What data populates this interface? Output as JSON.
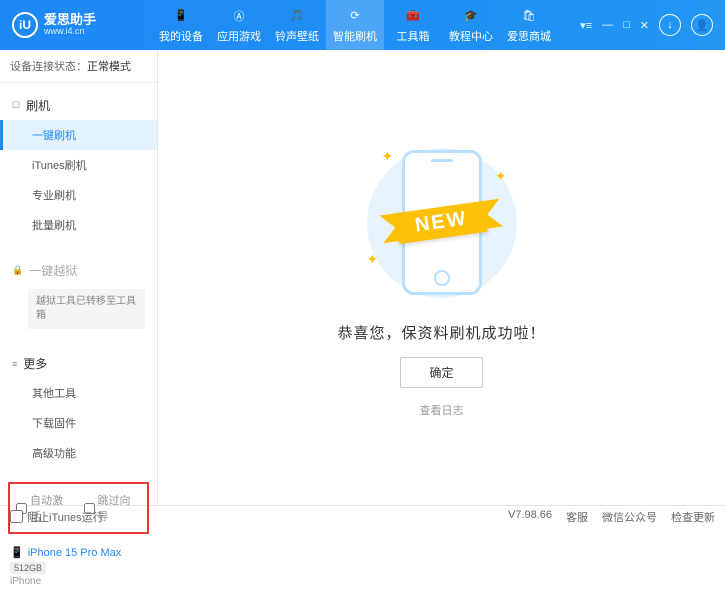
{
  "brand": {
    "title": "爱思助手",
    "subtitle": "www.i4.cn",
    "logo_letter": "iU"
  },
  "nav": {
    "items": [
      {
        "label": "我的设备"
      },
      {
        "label": "应用游戏"
      },
      {
        "label": "铃声壁纸"
      },
      {
        "label": "智能刷机"
      },
      {
        "label": "工具箱"
      },
      {
        "label": "教程中心"
      },
      {
        "label": "爱思商城"
      }
    ]
  },
  "status": {
    "label": "设备连接状态：",
    "value": "正常模式"
  },
  "sidebar": {
    "flash_header": "刷机",
    "flash_items": [
      {
        "label": "一键刷机"
      },
      {
        "label": "iTunes刷机"
      },
      {
        "label": "专业刷机"
      },
      {
        "label": "批量刷机"
      }
    ],
    "jailbreak_header": "一键越狱",
    "jailbreak_note": "越狱工具已转移至工具箱",
    "more_header": "更多",
    "more_items": [
      {
        "label": "其他工具"
      },
      {
        "label": "下载固件"
      },
      {
        "label": "高级功能"
      }
    ],
    "options": {
      "auto_activate": "自动激活",
      "skip_setup": "跳过向导"
    }
  },
  "device": {
    "name": "iPhone 15 Pro Max",
    "capacity": "512GB",
    "type": "iPhone"
  },
  "main": {
    "ribbon": "NEW",
    "success": "恭喜您，保资料刷机成功啦！",
    "confirm": "确定",
    "view_log": "查看日志"
  },
  "footer": {
    "block_itunes": "阻止iTunes运行",
    "version": "V7.98.66",
    "links": [
      "客服",
      "微信公众号",
      "检查更新"
    ]
  }
}
